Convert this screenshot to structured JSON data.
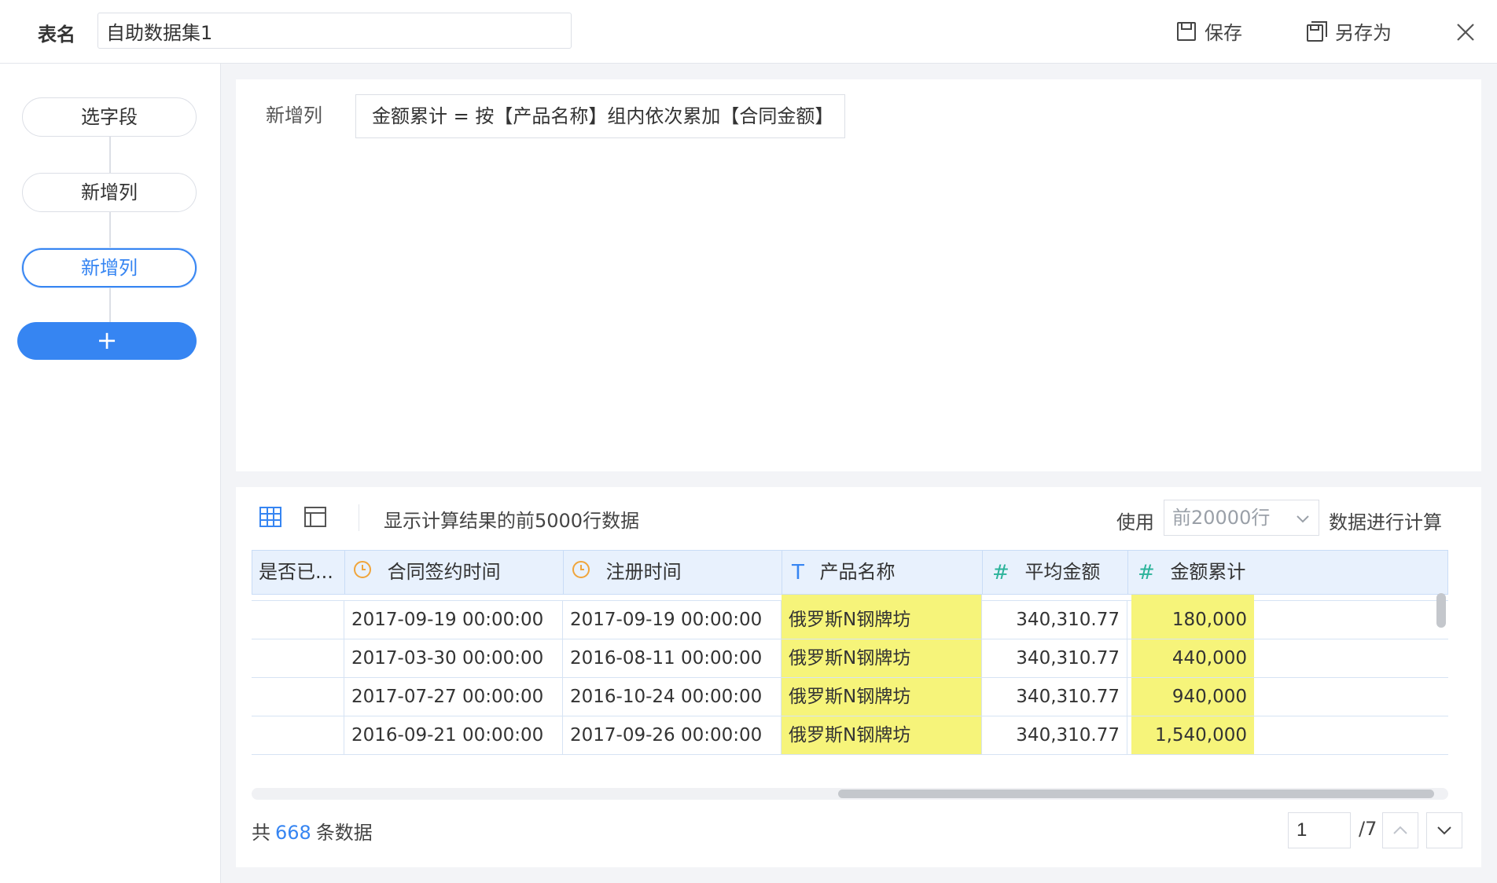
{
  "header": {
    "table_name_label": "表名",
    "table_name_value": "自助数据集1",
    "save_label": "保存",
    "save_as_label": "另存为"
  },
  "sidebar": {
    "steps": [
      {
        "label": "选字段"
      },
      {
        "label": "新增列"
      },
      {
        "label": "新增列"
      }
    ],
    "active_index": 2,
    "add_label": "+"
  },
  "formula": {
    "label": "新增列",
    "expression": "金额累计 = 按【产品名称】组内依次累加【合同金额】"
  },
  "preview": {
    "description": "显示计算结果的前5000行数据",
    "use_label": "使用",
    "rows_option": "前20000行",
    "calc_label": "数据进行计算"
  },
  "table": {
    "columns": [
      {
        "label": "是否已...",
        "type": "none"
      },
      {
        "label": "合同签约时间",
        "type": "date"
      },
      {
        "label": "注册时间",
        "type": "date"
      },
      {
        "label": "产品名称",
        "type": "text"
      },
      {
        "label": "平均金额",
        "type": "number"
      },
      {
        "label": "金额累计",
        "type": "number"
      }
    ],
    "rows": [
      [
        "",
        "2017-09-19 00:00:00",
        "2017-09-19 00:00:00",
        "俄罗斯N钢牌坊",
        "340,310.77",
        "180,000"
      ],
      [
        "",
        "2017-03-30 00:00:00",
        "2016-08-11 00:00:00",
        "俄罗斯N钢牌坊",
        "340,310.77",
        "440,000"
      ],
      [
        "",
        "2017-07-27 00:00:00",
        "2016-10-24 00:00:00",
        "俄罗斯N钢牌坊",
        "340,310.77",
        "940,000"
      ],
      [
        "",
        "2016-09-21 00:00:00",
        "2017-09-26 00:00:00",
        "俄罗斯N钢牌坊",
        "340,310.77",
        "1,540,000"
      ]
    ],
    "highlight_color": "#f6f47a"
  },
  "footer": {
    "count_prefix": "共",
    "count_value": "668",
    "count_suffix": "条数据",
    "current_page": "1",
    "total_pages": "/7"
  },
  "colors": {
    "accent": "#3685f2",
    "date_icon": "#f0a53b",
    "text_icon": "#3685f2",
    "number_icon": "#2bb39a"
  }
}
